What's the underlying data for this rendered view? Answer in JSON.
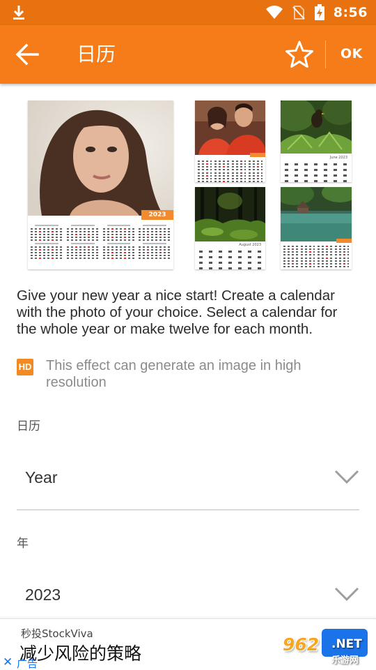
{
  "status_bar": {
    "time": "8:56",
    "icons": [
      "download-icon",
      "wifi-icon",
      "no-sim-icon",
      "battery-charging-icon"
    ]
  },
  "toolbar": {
    "title": "日历",
    "back_icon": "arrow-left-icon",
    "favorite_icon": "star-outline-icon",
    "ok_label": "OK"
  },
  "preview": {
    "badge_year": "2023",
    "month_june": "June 2023",
    "month_august": "August 2023"
  },
  "description": "Give your new year a nice start! Create a calendar with the photo of your choice. Select a calendar for the whole year or make twelve for each month.",
  "hd_notice": {
    "icon_text": "HD",
    "text": "This effect can generate an image in high resolution"
  },
  "calendar_field": {
    "label": "日历",
    "value": "Year"
  },
  "year_field": {
    "label": "年",
    "value": "2023"
  },
  "ad": {
    "advertiser": "秒投StockViva",
    "headline": "减少风险的策略",
    "close_symbol": "✕",
    "tag": "广告"
  },
  "watermark": {
    "number": "962",
    "domain": ".NET",
    "site": "乐游网"
  },
  "colors": {
    "status_bar": "#e8720f",
    "toolbar": "#f57c19",
    "accent": "#f08a24",
    "ad_cta": "#1a73e8"
  }
}
